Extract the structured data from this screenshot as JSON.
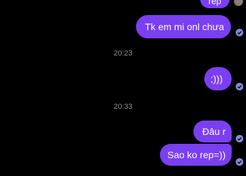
{
  "messages": [
    {
      "text": "rep",
      "status": "seen"
    },
    {
      "text": "Tk em mi onl chưa",
      "status": "sent"
    },
    {
      "text": ";)))",
      "status": "sent"
    },
    {
      "text": "Đâu r",
      "status": "sent"
    },
    {
      "text": "Sao ko rep=))",
      "status": "sent"
    }
  ],
  "timestamps": [
    "20:23",
    "20:33"
  ],
  "colors": {
    "bubble": "#7b3ff2",
    "background": "#000000",
    "timestamp": "#8e8e93",
    "check": "#7b8cdb"
  },
  "icons": {
    "status": "check-circle-icon",
    "seen": "avatar"
  }
}
